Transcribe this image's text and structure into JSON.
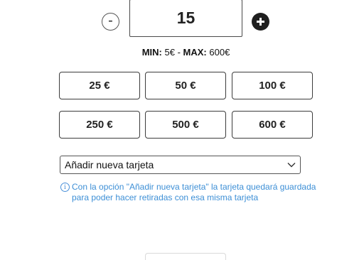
{
  "stepper": {
    "minus_label": "-",
    "value": "15"
  },
  "limits": {
    "min_label": "MIN:",
    "min_value": "5€",
    "separator": "-",
    "max_label": "MAX:",
    "max_value": "600€"
  },
  "quick_amounts": [
    "25 €",
    "50 €",
    "100 €",
    "250 €",
    "500 €",
    "600 €"
  ],
  "card_select": {
    "selected": "Añadir nueva tarjeta",
    "icon": "chevron-down-icon"
  },
  "info": {
    "icon": "info-icon",
    "text": "Con la opción \"Añadir nueva tarjeta\" la tarjeta quedará guardada para poder hacer retiradas con esa misma tarjeta"
  },
  "colors": {
    "info_blue": "#3d8fd6",
    "plus_button": "#1f1f1f"
  }
}
